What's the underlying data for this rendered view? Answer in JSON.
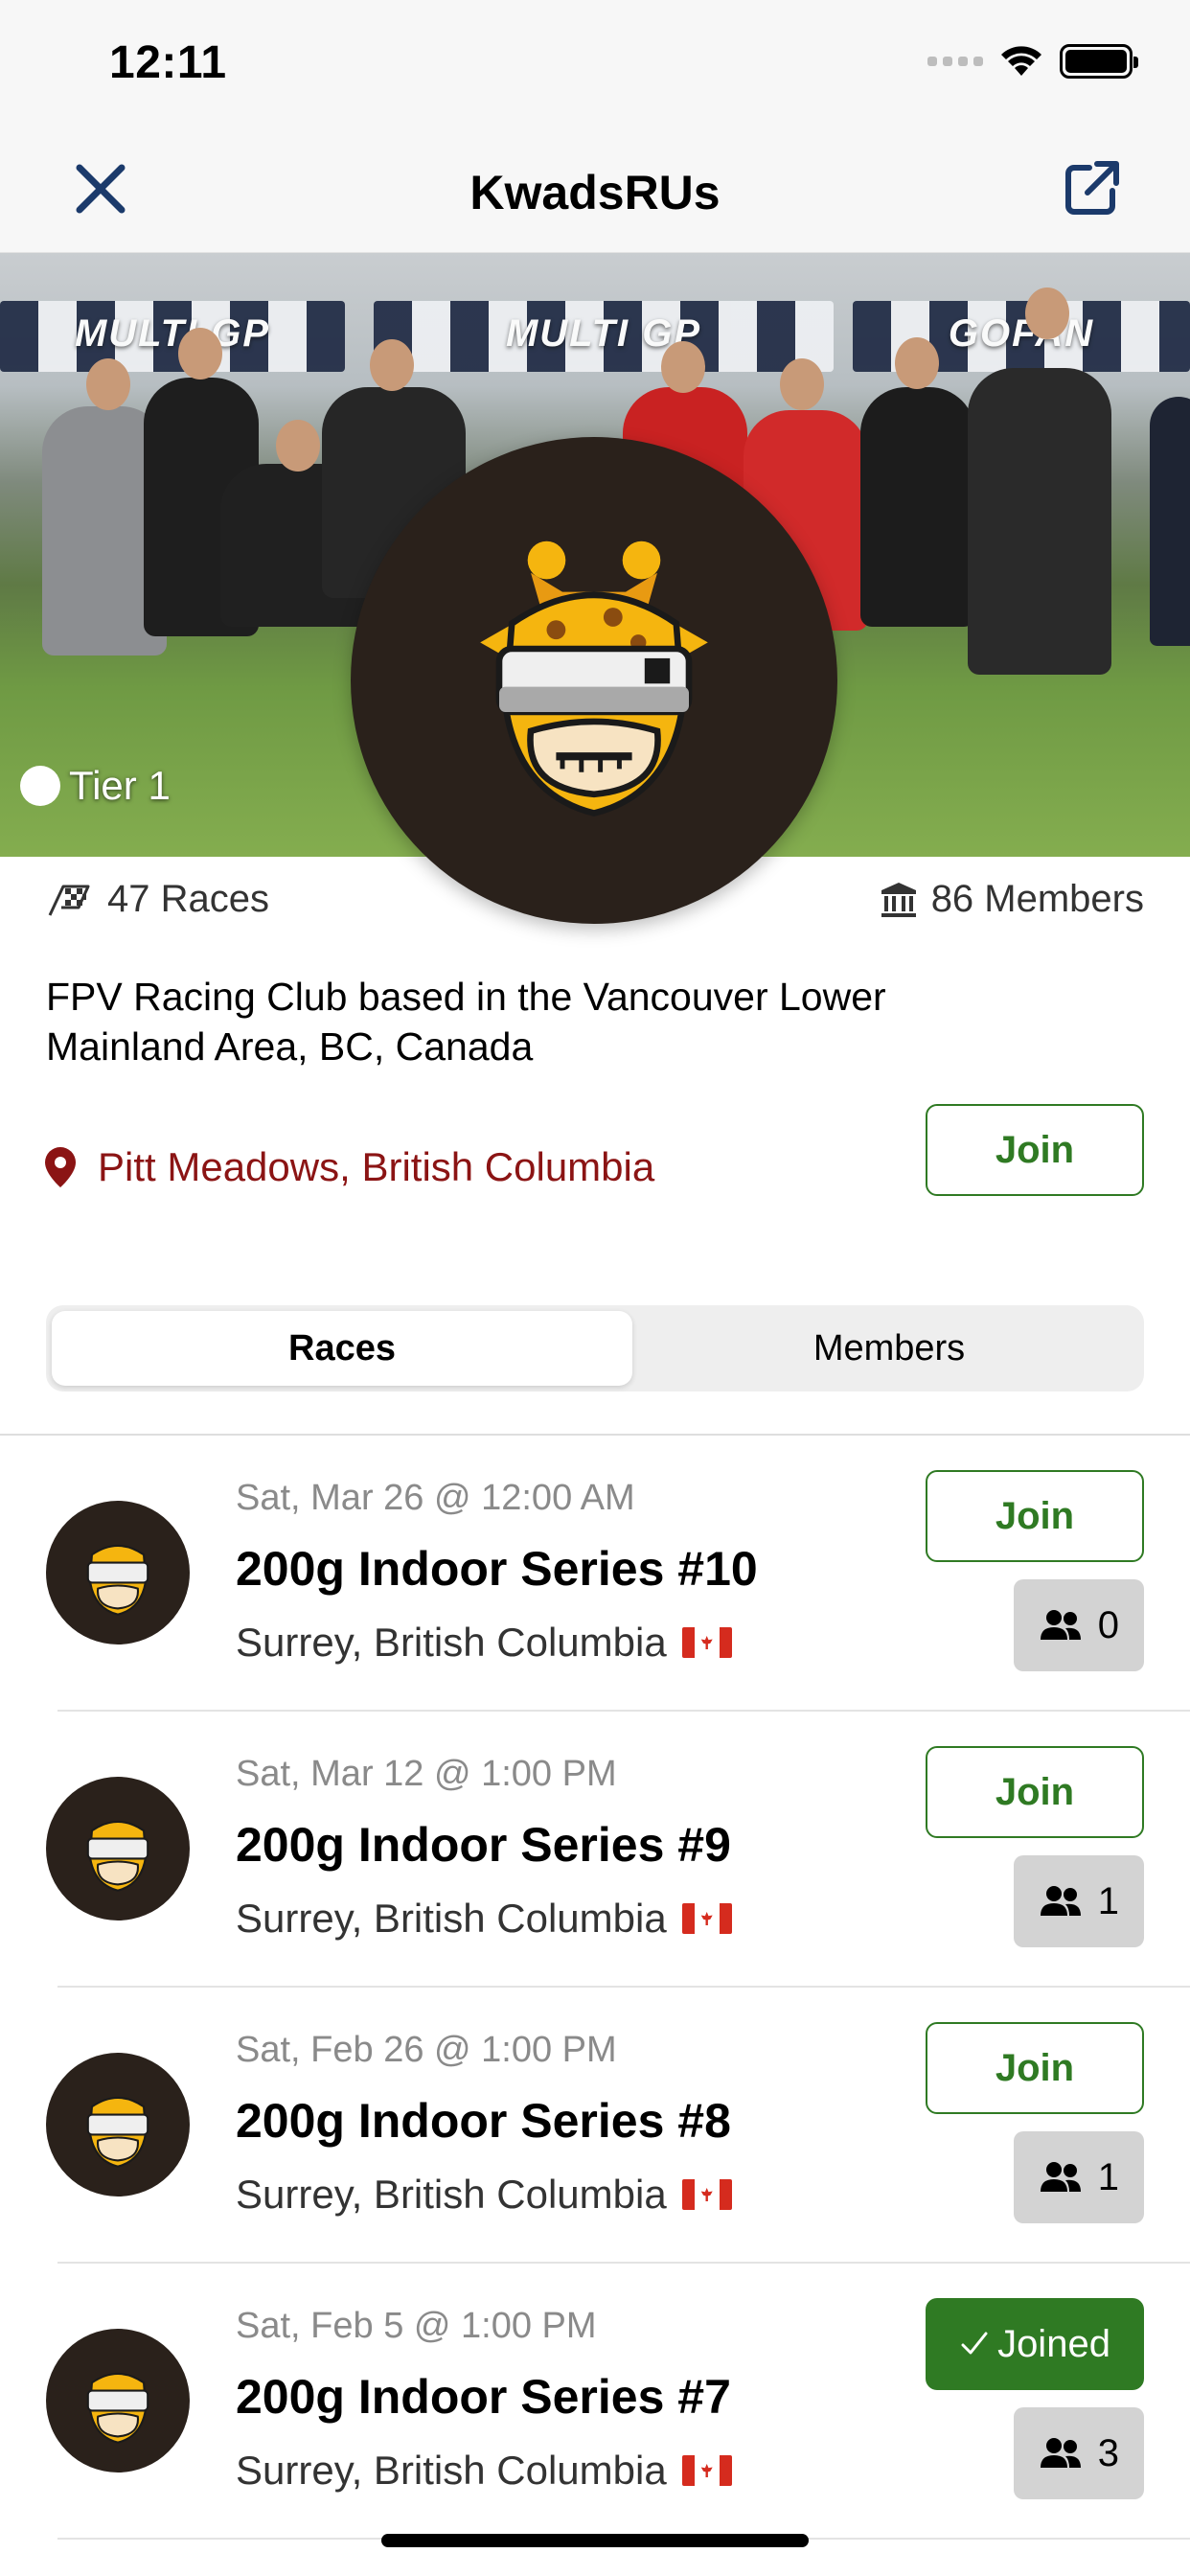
{
  "status_bar": {
    "time": "12:11"
  },
  "nav": {
    "title": "KwadsRUs"
  },
  "hero": {
    "tier_label": "Tier 1",
    "banners": [
      "MULTI GP",
      "MULTI GP",
      "GOFAN"
    ]
  },
  "stats": {
    "races": "47 Races",
    "members": "86 Members"
  },
  "club": {
    "description": "FPV Racing Club based in the Vancouver Lower Mainland Area, BC, Canada",
    "location": "Pitt Meadows, British Columbia",
    "join_label": "Join"
  },
  "segments": {
    "races": "Races",
    "members": "Members"
  },
  "races": [
    {
      "date": "Sat, Mar 26 @ 12:00 AM",
      "title": "200g Indoor Series #10",
      "location": "Surrey, British Columbia",
      "status": "Join",
      "joined": false,
      "member_count": "0"
    },
    {
      "date": "Sat, Mar 12 @ 1:00 PM",
      "title": "200g Indoor Series #9",
      "location": "Surrey, British Columbia",
      "status": "Join",
      "joined": false,
      "member_count": "1"
    },
    {
      "date": "Sat, Feb 26 @ 1:00 PM",
      "title": "200g Indoor Series #8",
      "location": "Surrey, British Columbia",
      "status": "Join",
      "joined": false,
      "member_count": "1"
    },
    {
      "date": "Sat, Feb 5 @ 1:00 PM",
      "title": "200g Indoor Series #7",
      "location": "Surrey, British Columbia",
      "status": "Joined",
      "joined": true,
      "member_count": "3"
    }
  ],
  "colors": {
    "accent_green": "#2f7a23",
    "location_red": "#8b1414",
    "logo_dark": "#2a211b",
    "logo_yellow": "#f5b50f"
  },
  "icons": [
    "close-icon",
    "share-icon",
    "checkered-flag-icon",
    "bank-icon",
    "location-pin-icon",
    "people-icon",
    "checkmark-icon"
  ]
}
